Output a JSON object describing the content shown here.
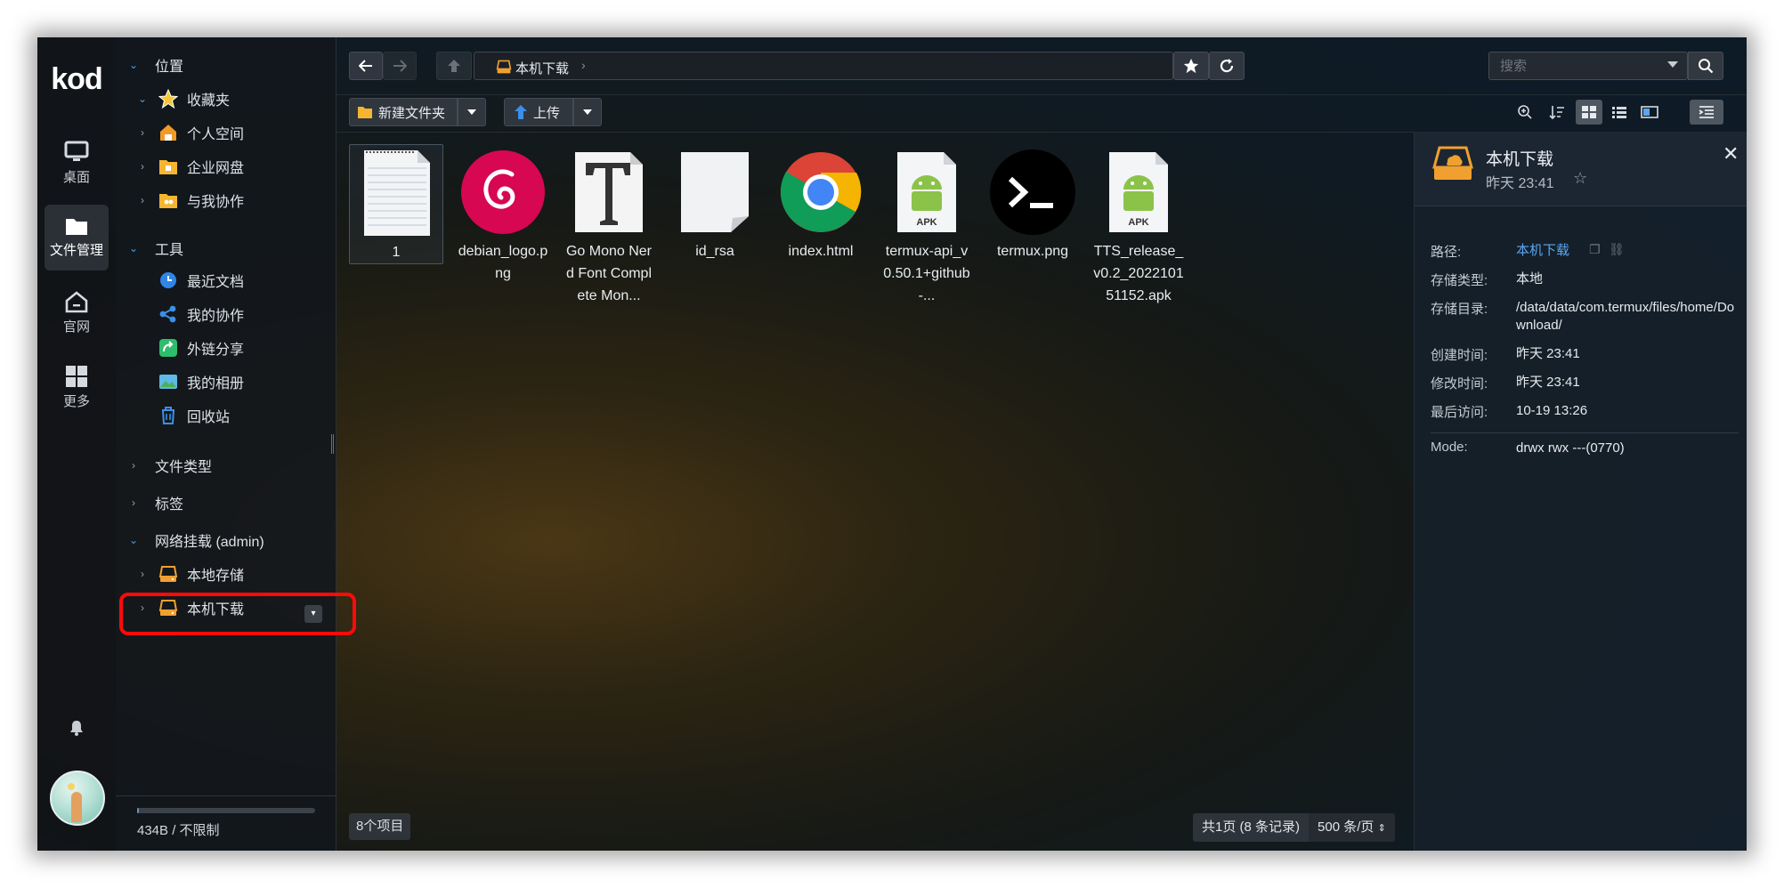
{
  "app": {
    "logo": "kod"
  },
  "rail": [
    {
      "label": "桌面",
      "icon": "monitor-icon"
    },
    {
      "label": "文件管理",
      "icon": "folder-icon"
    },
    {
      "label": "官网",
      "icon": "home-icon"
    },
    {
      "label": "更多",
      "icon": "grid-icon"
    }
  ],
  "tree": {
    "location_label": "位置",
    "favorites_label": "收藏夹",
    "personal_label": "个人空间",
    "enterprise_label": "企业网盘",
    "shared_label": "与我协作",
    "tools_label": "工具",
    "recent_label": "最近文档",
    "collab_label": "我的协作",
    "share_label": "外链分享",
    "album_label": "我的相册",
    "recycle_label": "回收站",
    "filetype_label": "文件类型",
    "tags_label": "标签",
    "mount_label": "网络挂载 (admin)",
    "local_storage_label": "本地存储",
    "local_download_label": "本机下载"
  },
  "quota": {
    "text": "434B / 不限制",
    "used_fraction": 0.01
  },
  "toolbar": {
    "path_crumb": "本机下载",
    "new_folder_label": "新建文件夹",
    "upload_label": "上传",
    "search_placeholder": "搜索"
  },
  "files": [
    {
      "name": "1",
      "type": "text"
    },
    {
      "name": "debian_logo.png",
      "type": "image"
    },
    {
      "name": "Go Mono Nerd Font Complete Mon...",
      "type": "font"
    },
    {
      "name": "id_rsa",
      "type": "file"
    },
    {
      "name": "index.html",
      "type": "html"
    },
    {
      "name": "termux-api_v0.50.1+github-...",
      "type": "apk"
    },
    {
      "name": "termux.png",
      "type": "image"
    },
    {
      "name": "TTS_release_v0.2_202210151152.apk",
      "type": "apk"
    }
  ],
  "status": {
    "item_count": "8个项目",
    "pager": "共1页 (8 条记录)",
    "per_page": "500 条/页"
  },
  "panel": {
    "title": "本机下载",
    "subtitle": "昨天 23:41",
    "path_label": "路径:",
    "path_value": "本机下载",
    "storage_type_label": "存储类型:",
    "storage_type_value": "本地",
    "storage_dir_label": "存储目录:",
    "storage_dir_value": "/data/data/com.termux/files/home/Download/",
    "created_label": "创建时间:",
    "created_value": "昨天 23:41",
    "modified_label": "修改时间:",
    "modified_value": "昨天 23:41",
    "accessed_label": "最后访问:",
    "accessed_value": "10-19 13:26",
    "mode_label": "Mode:",
    "mode_value": "drwx rwx ---(0770)"
  },
  "colors": {
    "accent": "#4a9fe8",
    "highlight": "#ff0a0a",
    "storage_icon": "#f0a030"
  }
}
